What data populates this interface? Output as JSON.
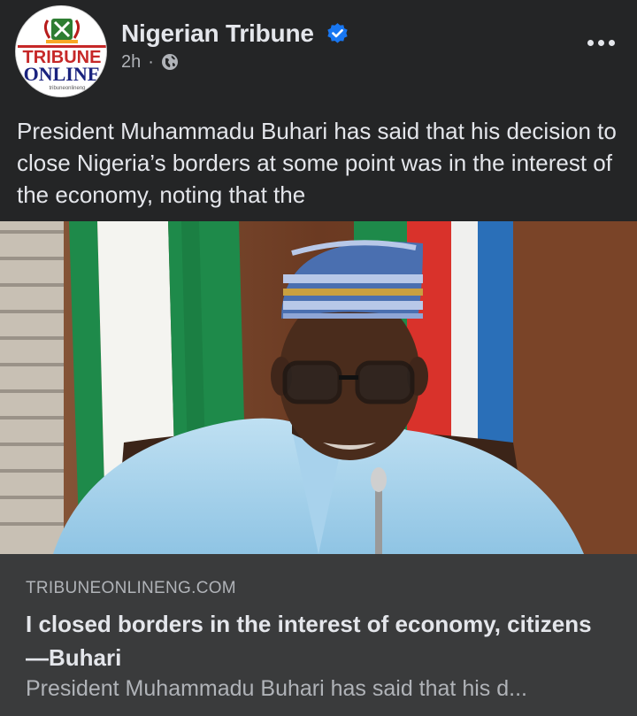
{
  "post": {
    "page_name": "Nigerian Tribune",
    "timestamp": "2h",
    "separator": "·",
    "audience_icon": "globe-icon",
    "verified_icon": "verified-badge-icon",
    "more_icon": "more-options-icon",
    "text": "President Muhammadu Buhari has said that his decision to close Nigeria’s borders at some point was in the interest of the economy, noting that the"
  },
  "avatar": {
    "logo_line1": "TRIBUNE",
    "logo_line2": "ONLINE",
    "logo_url": "tribuneonlineng"
  },
  "link": {
    "domain": "TRIBUNEONLINENG.COM",
    "title": "I closed borders in the interest of economy, citizens —Buhari",
    "description": "President Muhammadu Buhari has said that his d..."
  },
  "colors": {
    "background": "#242526",
    "link_card": "#3a3b3c",
    "verified_blue": "#1877f2",
    "primary_text": "#e4e6eb",
    "secondary_text": "#b0b3b8"
  }
}
